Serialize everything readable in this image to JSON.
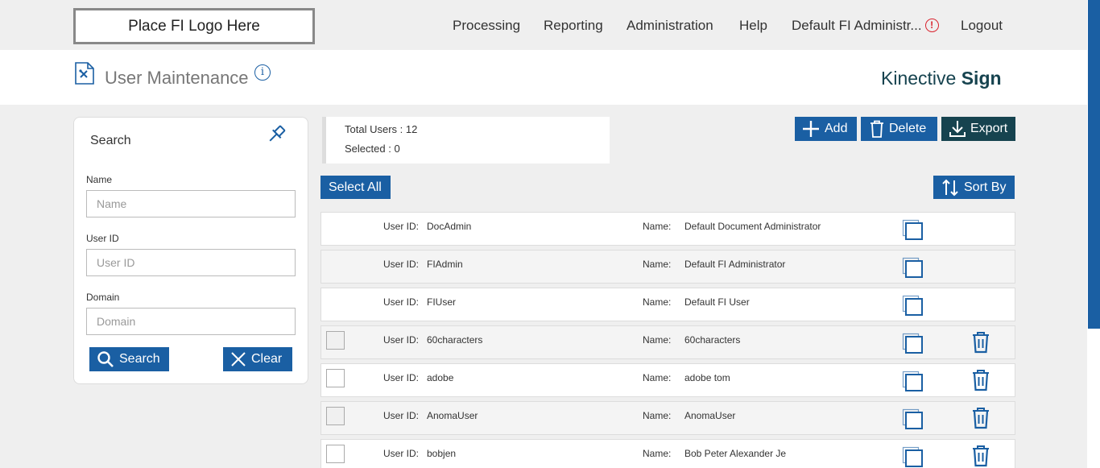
{
  "nav": {
    "logo_text": "Place FI Logo Here",
    "items": [
      "Processing",
      "Reporting",
      "Administration",
      "Help"
    ],
    "user": "Default FI Administr...",
    "alert_symbol": "!",
    "logout": "Logout"
  },
  "header": {
    "title": "User Maintenance",
    "info_symbol": "i",
    "brand_light": "Kinective ",
    "brand_bold": "Sign"
  },
  "search": {
    "title": "Search",
    "fields": [
      {
        "label": "Name",
        "placeholder": "Name",
        "value": ""
      },
      {
        "label": "User ID",
        "placeholder": "User ID",
        "value": ""
      },
      {
        "label": "Domain",
        "placeholder": "Domain",
        "value": ""
      }
    ],
    "search_button": "Search",
    "clear_button": "Clear"
  },
  "summary": {
    "total_label": "Total Users : ",
    "total": "12",
    "selected_label": "Selected : ",
    "selected": "0"
  },
  "toolbar": {
    "add": "Add",
    "delete": "Delete",
    "export": "Export",
    "select_all": "Select All",
    "sort_by": "Sort By"
  },
  "table": {
    "userid_label": "User ID:",
    "name_label": "Name:",
    "rows": [
      {
        "user_id": "DocAdmin",
        "name": "Default Document Administrator",
        "selectable": false
      },
      {
        "user_id": "FIAdmin",
        "name": "Default FI Administrator",
        "selectable": false
      },
      {
        "user_id": "FIUser",
        "name": "Default FI User",
        "selectable": false
      },
      {
        "user_id": "60characters",
        "name": "60characters",
        "selectable": true
      },
      {
        "user_id": "adobe",
        "name": "adobe tom",
        "selectable": true
      },
      {
        "user_id": "AnomaUser",
        "name": "AnomaUser",
        "selectable": true
      },
      {
        "user_id": "bobjen",
        "name": "Bob Peter Alexander Je",
        "selectable": true
      }
    ]
  },
  "colors": {
    "primary": "#1a5fa3",
    "export_bg": "#16434f",
    "alert": "#d9232e"
  }
}
